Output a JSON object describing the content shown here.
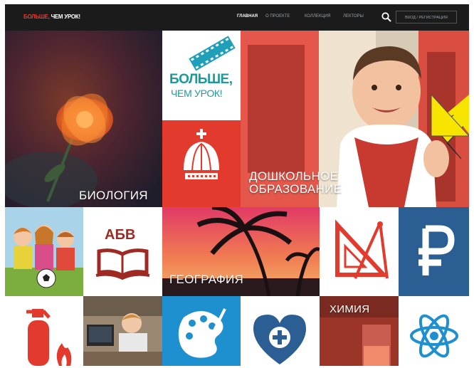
{
  "header": {
    "logo_part1": "БОЛЬШЕ,",
    "logo_part2": " ЧЕМ УРОК!",
    "nav": [
      "ГЛАВНАЯ",
      "О ПРОЕКТЕ",
      "КОЛЛЕКЦИЯ",
      "ЛЕКТОРЫ"
    ],
    "search_icon": "search-icon",
    "login_label": "ВХОД / РЕГИСТРАЦИЯ"
  },
  "brand_tile": {
    "line1": "БОЛЬШЕ,",
    "line2": "ЧЕМ УРОК!"
  },
  "tiles": {
    "biology": "БИОЛОГИЯ",
    "preschool_line1": "ДОШКОЛЬНОЕ",
    "preschool_line2": "ОБРАЗОВАНИЕ",
    "geography": "ГЕОГРАФИЯ",
    "chemistry": "ХИМИЯ",
    "alphabet": "АБВ"
  },
  "icons": [
    "crown-icon",
    "book-icon",
    "geometry-tools-icon",
    "ruble-icon",
    "fire-extinguisher-icon",
    "palette-icon",
    "heart-plus-icon",
    "atom-icon"
  ],
  "colors": {
    "accent_red": "#e23b2e",
    "dark_red": "#9e2a23",
    "blue": "#2e7fc0",
    "navy": "#2b5e92",
    "yellow": "#f7e500"
  }
}
